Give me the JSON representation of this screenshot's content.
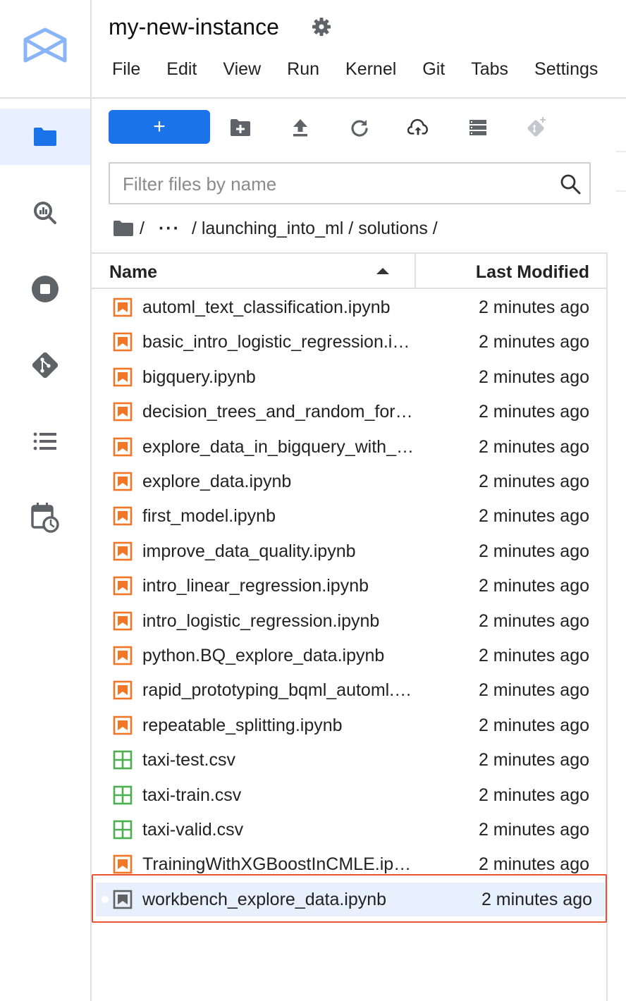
{
  "app": {
    "title": "my-new-instance",
    "menu": [
      "File",
      "Edit",
      "View",
      "Run",
      "Kernel",
      "Git",
      "Tabs",
      "Settings"
    ]
  },
  "sidebar": {
    "items": [
      {
        "name": "file-browser",
        "icon": "folder-icon",
        "active": true
      },
      {
        "name": "bigquery",
        "icon": "bigquery-search-icon",
        "active": false
      },
      {
        "name": "running-terminals-kernels",
        "icon": "stop-circle-icon",
        "active": false
      },
      {
        "name": "git",
        "icon": "git-icon",
        "active": false
      },
      {
        "name": "table-of-contents",
        "icon": "list-icon",
        "active": false
      },
      {
        "name": "scheduled-executions",
        "icon": "calendar-clock-icon",
        "active": false
      }
    ]
  },
  "toolbar": {
    "new_label": "+",
    "icons": [
      "new-folder-icon",
      "upload-icon",
      "refresh-icon",
      "cloud-upload-icon",
      "storage-icon",
      "git-clone-icon"
    ]
  },
  "filter": {
    "placeholder": "Filter files by name",
    "value": ""
  },
  "breadcrumbs": {
    "root": "/",
    "ellipsis": "···",
    "path": "/ launching_into_ml / solutions /"
  },
  "file_list": {
    "col_name": "Name",
    "col_modified": "Last Modified",
    "rows": [
      {
        "name": "automl_text_classification.ipynb",
        "modified": "2 minutes ago",
        "type": "notebook"
      },
      {
        "name": "basic_intro_logistic_regression.ipynb",
        "modified": "2 minutes ago",
        "type": "notebook"
      },
      {
        "name": "bigquery.ipynb",
        "modified": "2 minutes ago",
        "type": "notebook"
      },
      {
        "name": "decision_trees_and_random_forests.ipynb",
        "modified": "2 minutes ago",
        "type": "notebook"
      },
      {
        "name": "explore_data_in_bigquery_with_python.ipynb",
        "modified": "2 minutes ago",
        "type": "notebook"
      },
      {
        "name": "explore_data.ipynb",
        "modified": "2 minutes ago",
        "type": "notebook"
      },
      {
        "name": "first_model.ipynb",
        "modified": "2 minutes ago",
        "type": "notebook"
      },
      {
        "name": "improve_data_quality.ipynb",
        "modified": "2 minutes ago",
        "type": "notebook"
      },
      {
        "name": "intro_linear_regression.ipynb",
        "modified": "2 minutes ago",
        "type": "notebook"
      },
      {
        "name": "intro_logistic_regression.ipynb",
        "modified": "2 minutes ago",
        "type": "notebook"
      },
      {
        "name": "python.BQ_explore_data.ipynb",
        "modified": "2 minutes ago",
        "type": "notebook"
      },
      {
        "name": "rapid_prototyping_bqml_automl.ipynb",
        "modified": "2 minutes ago",
        "type": "notebook"
      },
      {
        "name": "repeatable_splitting.ipynb",
        "modified": "2 minutes ago",
        "type": "notebook"
      },
      {
        "name": "taxi-test.csv",
        "modified": "2 minutes ago",
        "type": "csv"
      },
      {
        "name": "taxi-train.csv",
        "modified": "2 minutes ago",
        "type": "csv"
      },
      {
        "name": "taxi-valid.csv",
        "modified": "2 minutes ago",
        "type": "csv"
      },
      {
        "name": "TrainingWithXGBoostInCMLE.ipynb",
        "modified": "2 minutes ago",
        "type": "notebook"
      },
      {
        "name": "workbench_explore_data.ipynb",
        "modified": "2 minutes ago",
        "type": "notebook-open",
        "selected": true
      }
    ]
  },
  "colors": {
    "accent": "#1a73e8",
    "selected_bg": "#e8f0fe",
    "notebook_icon": "#f37626",
    "csv_icon": "#4caf50",
    "highlight_border": "#e8542f"
  }
}
